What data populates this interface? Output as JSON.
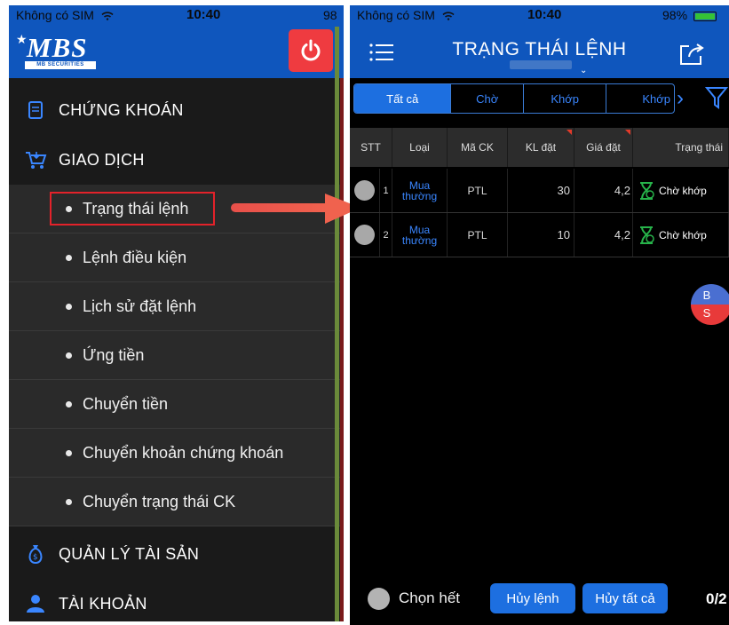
{
  "left_screen": {
    "status": {
      "carrier": "Không có SIM",
      "time": "10:40",
      "battery": "98"
    },
    "logo": {
      "name": "MBS",
      "subtitle": "MB SECURITIES"
    },
    "menu": [
      {
        "label": "CHỨNG KHOÁN",
        "icon": "document-icon"
      },
      {
        "label": "GIAO DỊCH",
        "icon": "cart-icon"
      }
    ],
    "submenu": [
      "Trạng thái lệnh",
      "Lệnh điều kiện",
      "Lịch sử đặt lệnh",
      "Ứng tiền",
      "Chuyển tiền",
      "Chuyển khoản chứng khoán",
      "Chuyển trạng thái CK"
    ],
    "menu_bottom": [
      {
        "label": "QUẢN LÝ TÀI SẢN",
        "icon": "money-bag-icon"
      },
      {
        "label": "TÀI KHOẢN",
        "icon": "user-icon"
      }
    ]
  },
  "right_screen": {
    "status": {
      "carrier": "Không có SIM",
      "time": "10:40",
      "battery": "98%"
    },
    "title": "TRẠNG THÁI LỆNH",
    "tabs": [
      "Tất cả",
      "Chờ",
      "Khớp",
      "Khớp"
    ],
    "columns": [
      "STT",
      "Loại",
      "Mã CK",
      "KL đặt",
      "Giá đặt",
      "Trạng thái"
    ],
    "rows": [
      {
        "stt": "1",
        "type_line1": "Mua",
        "type_line2": "thường",
        "symbol": "PTL",
        "qty": "30",
        "price": "4,2",
        "status": "Chờ khớp"
      },
      {
        "stt": "2",
        "type_line1": "Mua",
        "type_line2": "thường",
        "symbol": "PTL",
        "qty": "10",
        "price": "4,2",
        "status": "Chờ khớp"
      }
    ],
    "badge": {
      "buy": "B",
      "sell": "S"
    },
    "bottom": {
      "select_all": "Chọn hết",
      "cancel_order": "Hủy lệnh",
      "cancel_all": "Hủy tất cả",
      "page": "0/2"
    }
  },
  "colors": {
    "brand_blue": "#0f56bd",
    "accent_blue": "#1d6fe0",
    "power_red": "#ef3b40",
    "highlight_red": "#e3222a",
    "status_green": "#27b34a"
  }
}
